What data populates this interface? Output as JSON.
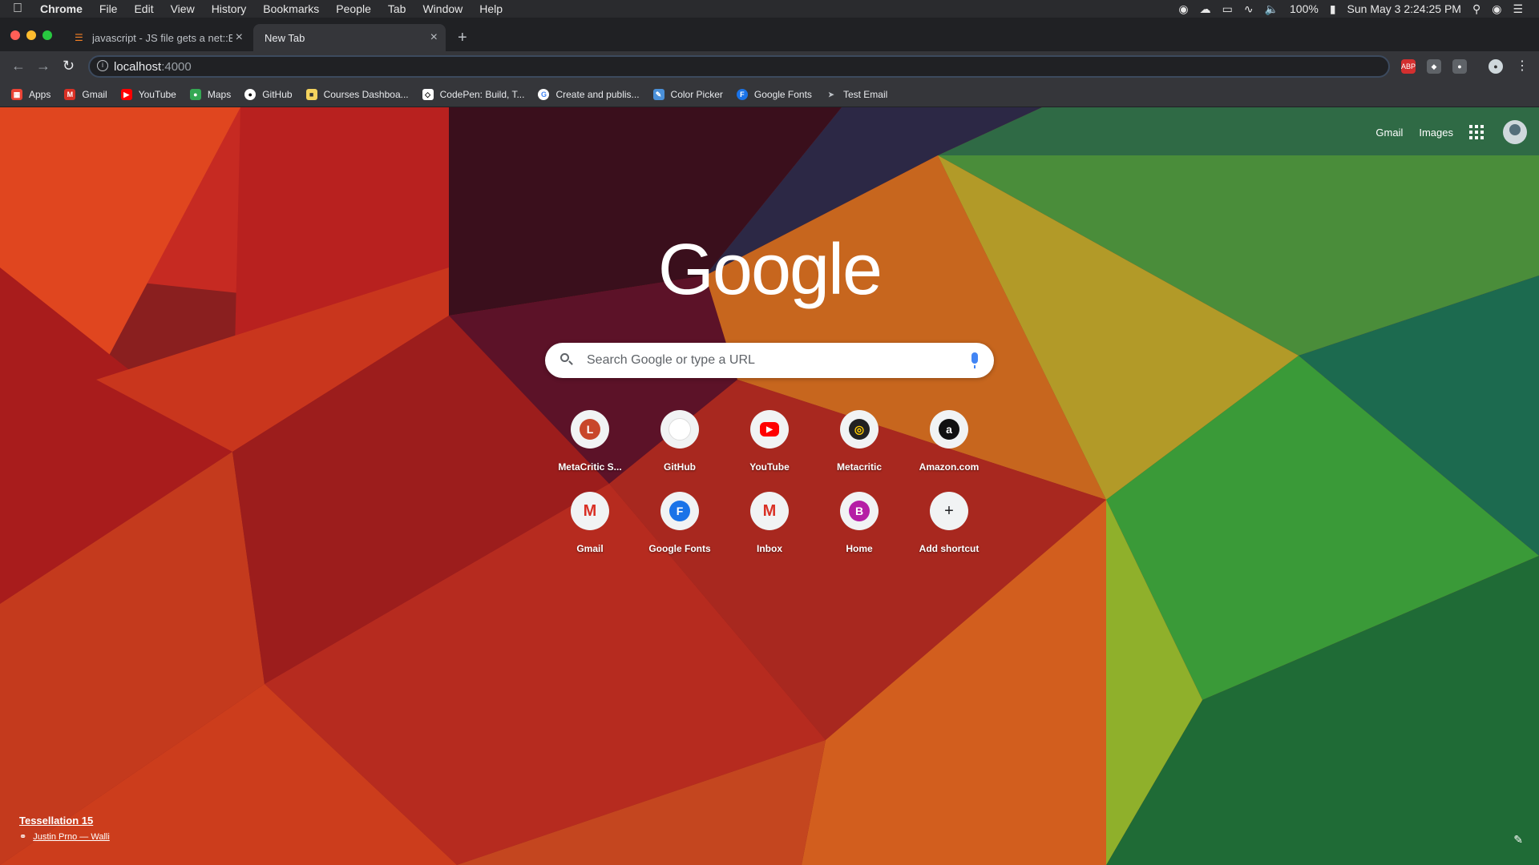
{
  "menubar": {
    "app": "Chrome",
    "items": [
      "File",
      "Edit",
      "View",
      "History",
      "Bookmarks",
      "People",
      "Tab",
      "Window",
      "Help"
    ],
    "battery": "100%",
    "datetime": "Sun May 3  2:24:25 PM"
  },
  "tabs": [
    {
      "title": "javascript - JS file gets a net::E",
      "active": false
    },
    {
      "title": "New Tab",
      "active": true
    }
  ],
  "omnibox": {
    "host": "localhost",
    "port": ":4000"
  },
  "extensions": [
    "ABP",
    "shield",
    "bitmoji",
    "profile"
  ],
  "bookmarks": [
    {
      "label": "Apps",
      "icon": "apps-icon",
      "color": "#ea4335"
    },
    {
      "label": "Gmail",
      "icon": "gmail-icon",
      "color": "#d93025"
    },
    {
      "label": "YouTube",
      "icon": "youtube-icon",
      "color": "#ff0000"
    },
    {
      "label": "Maps",
      "icon": "maps-icon",
      "color": "#34a853"
    },
    {
      "label": "GitHub",
      "icon": "github-icon",
      "color": "#ffffff"
    },
    {
      "label": "Courses Dashboa...",
      "icon": "courses-icon",
      "color": "#f4d35e"
    },
    {
      "label": "CodePen: Build, T...",
      "icon": "codepen-icon",
      "color": "#ffffff"
    },
    {
      "label": "Create and publis...",
      "icon": "google-icon",
      "color": "#4285f4"
    },
    {
      "label": "Color Picker",
      "icon": "color-picker-icon",
      "color": "#4a90d9"
    },
    {
      "label": "Google Fonts",
      "icon": "google-fonts-icon",
      "color": "#1a73e8"
    },
    {
      "label": "Test Email",
      "icon": "test-email-icon",
      "color": "#9aa0a6"
    }
  ],
  "top_links": {
    "gmail": "Gmail",
    "images": "Images"
  },
  "logo": "Google",
  "search": {
    "placeholder": "Search Google or type a URL"
  },
  "shortcuts": [
    {
      "label": "MetaCritic S...",
      "glyph": "L",
      "color": "#c8472b"
    },
    {
      "label": "GitHub",
      "glyph": "",
      "color": "#ffffff"
    },
    {
      "label": "YouTube",
      "glyph": "▶",
      "color": "#ff0000"
    },
    {
      "label": "Metacritic",
      "glyph": "◎",
      "color": "#222222"
    },
    {
      "label": "Amazon.com",
      "glyph": "a",
      "color": "#111111"
    },
    {
      "label": "Gmail",
      "glyph": "M",
      "color": "#d93025"
    },
    {
      "label": "Google Fonts",
      "glyph": "F",
      "color": "#1a73e8"
    },
    {
      "label": "Inbox",
      "glyph": "M",
      "color": "#d93025"
    },
    {
      "label": "Home",
      "glyph": "B",
      "color": "#b51ea5"
    },
    {
      "label": "Add shortcut",
      "glyph": "+",
      "color": "#202124"
    }
  ],
  "attribution": {
    "title": "Tessellation 15",
    "author": "Justin Prno — Walli"
  }
}
